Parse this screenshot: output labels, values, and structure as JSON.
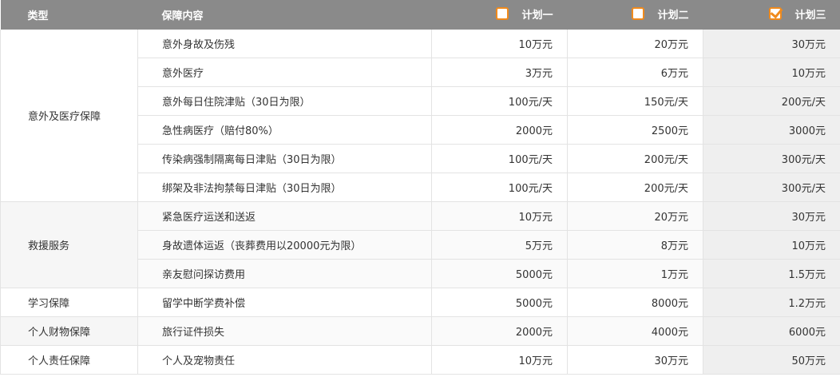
{
  "header": {
    "type_label": "类型",
    "content_label": "保障内容",
    "plans": [
      {
        "label": "计划一",
        "checked": false
      },
      {
        "label": "计划二",
        "checked": false
      },
      {
        "label": "计划三",
        "checked": true
      }
    ]
  },
  "groups": [
    {
      "type": "意外及医疗保障"
    },
    {
      "type": "救援服务"
    },
    {
      "type": "学习保障"
    },
    {
      "type": "个人财物保障"
    },
    {
      "type": "个人责任保障"
    }
  ],
  "rows": [
    {
      "item": "意外身故及伤残",
      "p1": "10万元",
      "p2": "20万元",
      "p3": "30万元"
    },
    {
      "item": "意外医疗",
      "p1": "3万元",
      "p2": "6万元",
      "p3": "10万元"
    },
    {
      "item": "意外每日住院津贴（30日为限）",
      "p1": "100元/天",
      "p2": "150元/天",
      "p3": "200元/天"
    },
    {
      "item": "急性病医疗（赔付80%）",
      "p1": "2000元",
      "p2": "2500元",
      "p3": "3000元"
    },
    {
      "item": "传染病强制隔离每日津贴（30日为限）",
      "p1": "100元/天",
      "p2": "200元/天",
      "p3": "300元/天"
    },
    {
      "item": "绑架及非法拘禁每日津贴（30日为限）",
      "p1": "100元/天",
      "p2": "200元/天",
      "p3": "300元/天"
    },
    {
      "item": "紧急医疗运送和送返",
      "p1": "10万元",
      "p2": "20万元",
      "p3": "30万元"
    },
    {
      "item": "身故遗体运返（丧葬费用以20000元为限）",
      "p1": "5万元",
      "p2": "8万元",
      "p3": "10万元"
    },
    {
      "item": "亲友慰问探访费用",
      "p1": "5000元",
      "p2": "1万元",
      "p3": "1.5万元"
    },
    {
      "item": "留学中断学费补偿",
      "p1": "5000元",
      "p2": "8000元",
      "p3": "1.2万元"
    },
    {
      "item": "旅行证件损失",
      "p1": "2000元",
      "p2": "4000元",
      "p3": "6000元"
    },
    {
      "item": "个人及宠物责任",
      "p1": "10万元",
      "p2": "30万元",
      "p3": "50万元"
    }
  ],
  "colors": {
    "header_bg": "#8a8a8a",
    "accent": "#f08a1c",
    "highlight_col": "#efefef"
  }
}
